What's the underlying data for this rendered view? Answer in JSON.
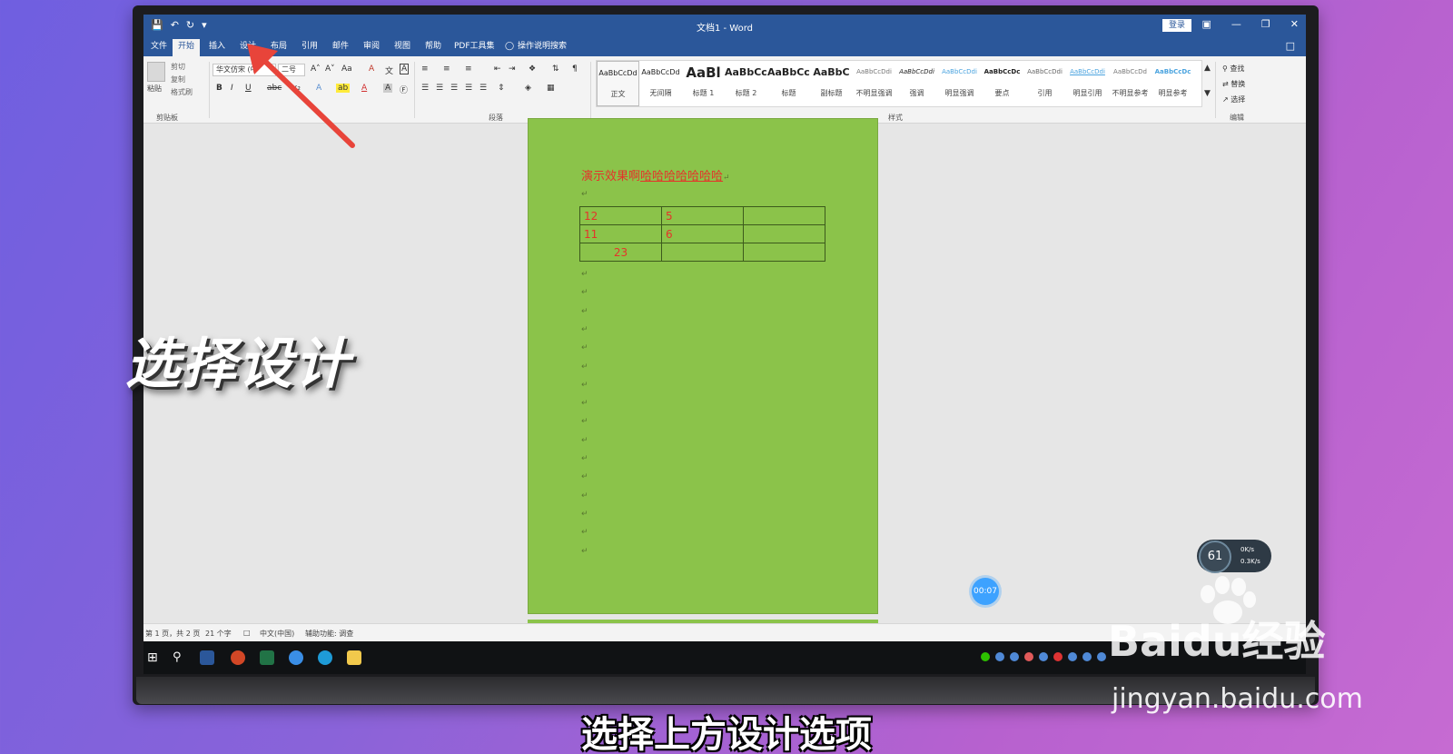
{
  "window": {
    "title": "文档1 - Word",
    "login_label": "登录"
  },
  "tabs": [
    {
      "label": "文件"
    },
    {
      "label": "开始"
    },
    {
      "label": "插入"
    },
    {
      "label": "设计"
    },
    {
      "label": "布局"
    },
    {
      "label": "引用"
    },
    {
      "label": "邮件"
    },
    {
      "label": "审阅"
    },
    {
      "label": "视图"
    },
    {
      "label": "帮助"
    },
    {
      "label": "PDF工具集"
    },
    {
      "label": "操作说明搜索"
    }
  ],
  "ribbon": {
    "clipboard": {
      "paste": "粘贴",
      "cut": "剪切",
      "copy": "复制",
      "format_painter": "格式刷",
      "group_label": "剪贴板"
    },
    "font": {
      "font_name": "华文仿宋 (中",
      "font_size": "二号"
    },
    "paragraph_label": "段落",
    "styles_label": "样式",
    "styles": [
      {
        "sample": "AaBbCcDd",
        "name": "正文"
      },
      {
        "sample": "AaBbCcDd",
        "name": "无间隔"
      },
      {
        "sample": "AaBl",
        "name": "标题 1"
      },
      {
        "sample": "AaBbCcl",
        "name": "标题 2"
      },
      {
        "sample": "AaBbCcl",
        "name": "标题"
      },
      {
        "sample": "AaBbC",
        "name": "副标题"
      },
      {
        "sample": "AaBbCcDdi",
        "name": "不明显强调"
      },
      {
        "sample": "AaBbCcDdi",
        "name": "强调"
      },
      {
        "sample": "AaBbCcDdi",
        "name": "明显强调"
      },
      {
        "sample": "AaBbCcDc",
        "name": "要点"
      },
      {
        "sample": "AaBbCcDdi",
        "name": "引用"
      },
      {
        "sample": "AaBbCcDdi",
        "name": "明显引用"
      },
      {
        "sample": "AaBbCcDd",
        "name": "不明显参考"
      },
      {
        "sample": "AaBbCcDc",
        "name": "明显参考"
      }
    ],
    "editing": {
      "find": "查找",
      "replace": "替换",
      "select": "选择",
      "group_label": "编辑"
    }
  },
  "document": {
    "heading_plain": "演示效果啊",
    "heading_underlined": "哈哈哈哈哈哈哈",
    "table": [
      [
        "12",
        "5",
        ""
      ],
      [
        "11",
        "6",
        ""
      ],
      [
        "23",
        "",
        ""
      ]
    ]
  },
  "statusbar": {
    "page": "第 1 页，共 2 页",
    "words": "21 个字",
    "language": "中文(中国)",
    "accessibility": "辅助功能: 调查"
  },
  "widgets": {
    "net_percent": "61",
    "net_up": "0K/s",
    "net_down": "0.3K/s",
    "timer": "00:07"
  },
  "overlay": {
    "callout": "选择设计",
    "subtitle": "选择上方设计选项",
    "watermark": "Baidu经验",
    "watermark_url": "jingyan.baidu.com"
  },
  "colors": {
    "word_blue": "#2b579a",
    "page_green": "#8bc34a",
    "doc_text_red": "#e5332a",
    "arrow_red": "#e8443a"
  }
}
